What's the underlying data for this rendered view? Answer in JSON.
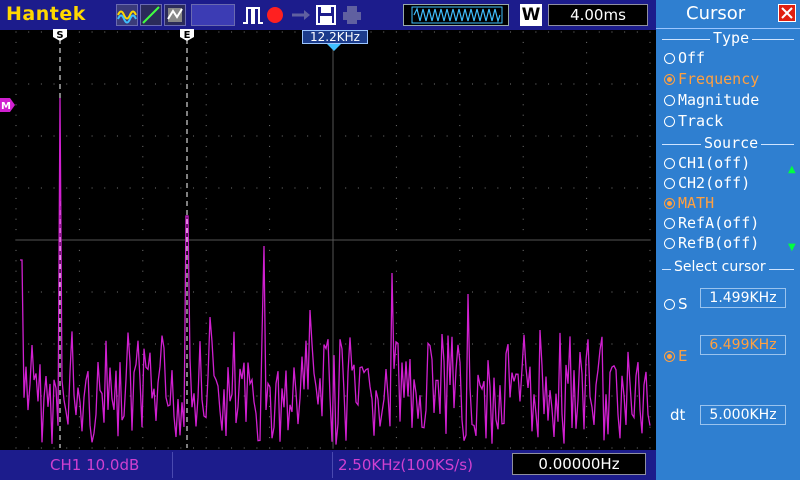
{
  "toolbar": {
    "brand": "Hantek",
    "timebase": "4.00ms",
    "window_label": "W"
  },
  "panel": {
    "title": "Cursor",
    "type_section": "Type",
    "type_options": [
      "Off",
      "Frequency",
      "Magnitude",
      "Track"
    ],
    "type_selected": "Frequency",
    "source_section": "Source",
    "source_options": [
      "CH1(off)",
      "CH2(off)",
      "MATH",
      "RefA(off)",
      "RefB(off)"
    ],
    "source_selected": "MATH",
    "select_section": "Select cursor",
    "cursor_s_label": "S",
    "cursor_s_value": "1.499KHz",
    "cursor_e_label": "E",
    "cursor_e_value": "6.499KHz",
    "selected_cursor": "E",
    "dt_label": "dt",
    "dt_value": "5.000KHz"
  },
  "scope": {
    "cursor_center_readout": "12.2KHz",
    "cursor_s_marker": "S",
    "cursor_e_marker": "E",
    "math_marker": "M",
    "trace_color": "#d020d0"
  },
  "bottombar": {
    "ch1_scale": "CH1 10.0dB",
    "sample_info": "2.50KHz(100KS/s)",
    "frequency": "0.00000Hz"
  },
  "colors": {
    "toolbar_bg": "#1c1c8c",
    "panel_bg": "#2f7fd0",
    "selected": "#ffa040",
    "trace": "#d020d0",
    "grid": "#6a6a6a"
  }
}
